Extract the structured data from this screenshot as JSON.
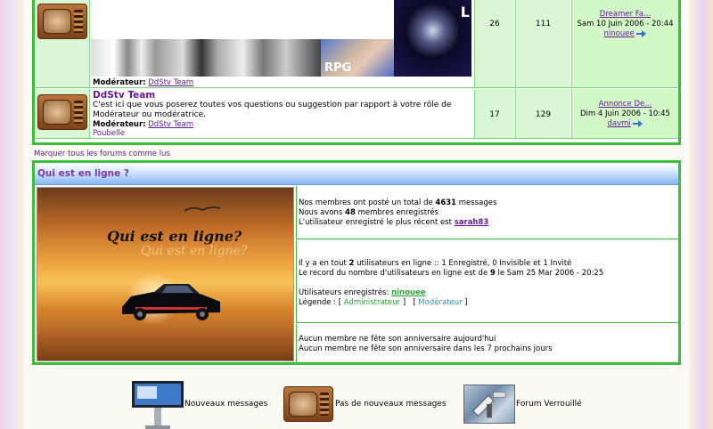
{
  "forums": [
    {
      "topics": "26",
      "posts": "111",
      "last_post": {
        "title": "Dreamer Fa...",
        "date": "Sam 10 Juin 2006 - 20:44",
        "author": "ninouee"
      },
      "moderator_label": "Modérateur:",
      "moderator": "DdStv Team",
      "banner_text_rpg": "RPG",
      "banner_text_mask": "L"
    },
    {
      "title": "DdStv Team",
      "description": "C'est ici que vous poserez toutes vos questions ou suggestion par rapport à votre rôle de Modérateur ou modératrice.",
      "moderator_label": "Modérateur:",
      "moderator": "DdStv Team",
      "subforum": "Poubelle",
      "topics": "17",
      "posts": "129",
      "last_post": {
        "title": "Annonce De...",
        "date": "Dim 4 Juin 2006 - 10:45",
        "author": "davmi"
      }
    }
  ],
  "mark_all_read": "Marquer tous les forums comme lus",
  "online": {
    "header": "Qui est en ligne ?",
    "image_title": "Qui est en ligne?",
    "image_title_echo": "Qui est en ligne?",
    "stats": {
      "line1_pre": "Nos membres ont posté un total de ",
      "total_posts": "4631",
      "line1_post": " messages",
      "line2_pre": "Nous avons ",
      "total_members": "48",
      "line2_post": " membres enregistrés",
      "line3_pre": "L'utilisateur enregistré le plus récent est ",
      "newest_user": "sarah83"
    },
    "users": {
      "line1_pre": "Il y a en tout ",
      "total_online": "2",
      "line1_post": " utilisateurs en ligne :: 1 Enregistré, 0 Invisible et 1 Invité",
      "record_pre": "Le record du nombre d'utilisateurs en ligne est de ",
      "record": "9",
      "record_post": " le Sam 25 Mar 2006 - 20:25",
      "registered_label": "Utilisateurs enregistrés: ",
      "registered_user": "ninouee",
      "legend_label": "Légende : ",
      "legend_admin": "Administrateur",
      "legend_mod": "Modérateur"
    },
    "birthdays": {
      "today": "Aucun membre ne fête son anniversaire aujourd'hui",
      "week": "Aucun membre ne fête son anniversaire dans les 7 prochains jours"
    }
  },
  "legend": {
    "new_posts": "Nouveaux messages",
    "no_new_posts": "Pas de nouveaux messages",
    "locked": "Forum Verrouillé"
  },
  "colors": {
    "border_green": "#3bbf3b",
    "cell_green": "#d9f7d4",
    "link_purple": "#6a1b9a",
    "admin_green": "#2ea33a",
    "mod_blue": "#3a8fb0"
  },
  "icons": {
    "forum": "tv-icon",
    "arrow": "goto-last-post-icon",
    "new_posts": "kiosk-icon",
    "locked": "satellite-icon"
  }
}
